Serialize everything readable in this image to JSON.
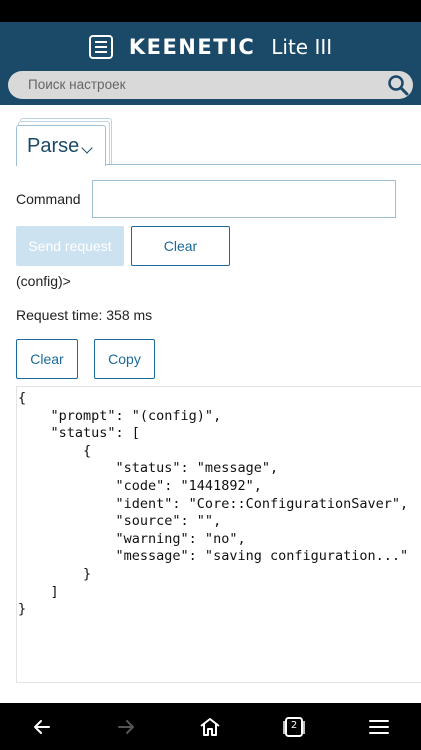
{
  "header": {
    "brand": "KEENETIC",
    "model": "Lite III",
    "menu_icon": "menu-icon"
  },
  "search": {
    "placeholder": "Поиск настроек",
    "icon": "search-icon"
  },
  "tabs": [
    {
      "label": "Parse",
      "selected": true
    }
  ],
  "form": {
    "command_label": "Command",
    "command_value": "",
    "send_label": "Send request",
    "clear_label": "Clear"
  },
  "result": {
    "prompt_line": "(config)>",
    "request_time": "Request time: 358 ms",
    "clear_label": "Clear",
    "copy_label": "Copy",
    "output": "{\n    \"prompt\": \"(config)\",\n    \"status\": [\n        {\n            \"status\": \"message\",\n            \"code\": \"1441892\",\n            \"ident\": \"Core::ConfigurationSaver\",\n            \"source\": \"\",\n            \"warning\": \"no\",\n            \"message\": \"saving configuration...\"\n        }\n    ]\n}"
  },
  "nav": {
    "back_icon": "back-arrow-icon",
    "forward_icon": "forward-arrow-icon",
    "home_icon": "home-icon",
    "tabs_icon": "tabs-icon",
    "tabs_count": "2",
    "menu_icon": "hamburger-menu-icon"
  },
  "colors": {
    "header_bg": "#1b4a68",
    "accent": "#1b6a99",
    "disabled_button": "#cde2f0"
  }
}
